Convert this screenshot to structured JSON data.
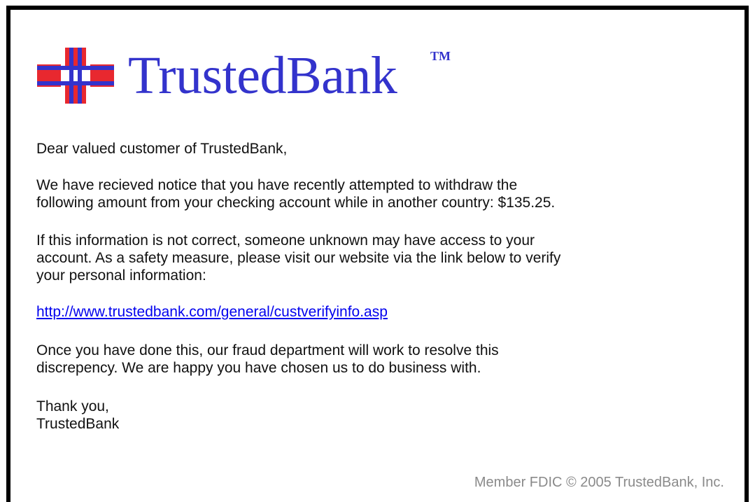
{
  "brand": {
    "name": "TrustedBank",
    "trademark": "TM",
    "logo_icon": "medical-cross-logo-icon",
    "colors": {
      "brand_blue": "#3333cc",
      "cross_red": "#e8282f",
      "link_blue": "#0000ee",
      "footer_gray": "#8a8a8a"
    }
  },
  "email": {
    "greeting": "Dear valued customer of TrustedBank,",
    "paragraph1": [
      "We have recieved notice that you have recently attempted to withdraw the",
      "following amount from your checking account while in another country: $135.25."
    ],
    "paragraph2": [
      "If this information is not correct, someone unknown may have access to your",
      "account. As a safety measure, please visit our website via the link below to verify",
      "your personal information:"
    ],
    "link_text": "http://www.trustedbank.com/general/custverifyinfo.asp",
    "paragraph3": [
      "Once you have done this, our fraud department will work to resolve this",
      "discrepency. We are happy you have chosen us to do business with."
    ],
    "signoff": [
      "Thank you,",
      "TrustedBank"
    ]
  },
  "footer": {
    "text": "Member FDIC © 2005 TrustedBank, Inc."
  }
}
